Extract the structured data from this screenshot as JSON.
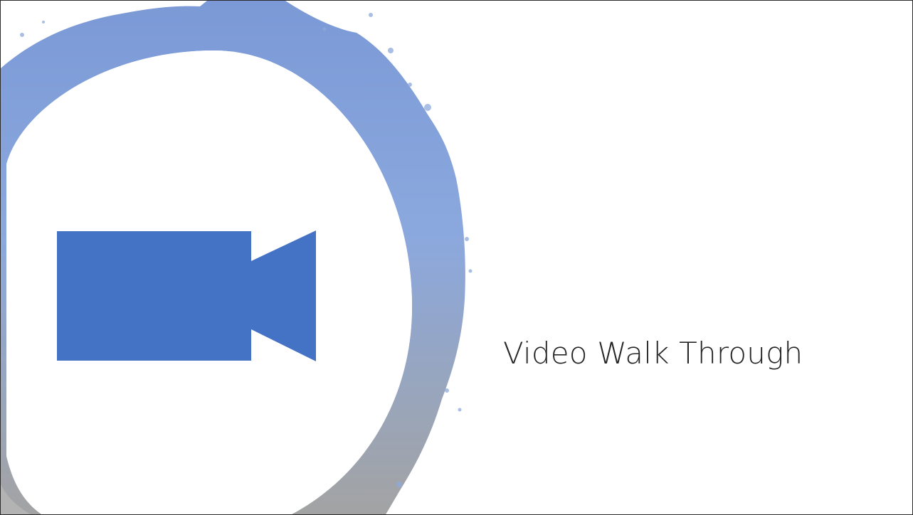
{
  "slide": {
    "title": "Video Walk Through",
    "icon": "video-camera-icon",
    "colors": {
      "icon": "#4472c4",
      "ring_top": "#8ea9db",
      "ring_bottom": "#a6a6a6",
      "text": "#262626",
      "background": "#ffffff"
    }
  }
}
